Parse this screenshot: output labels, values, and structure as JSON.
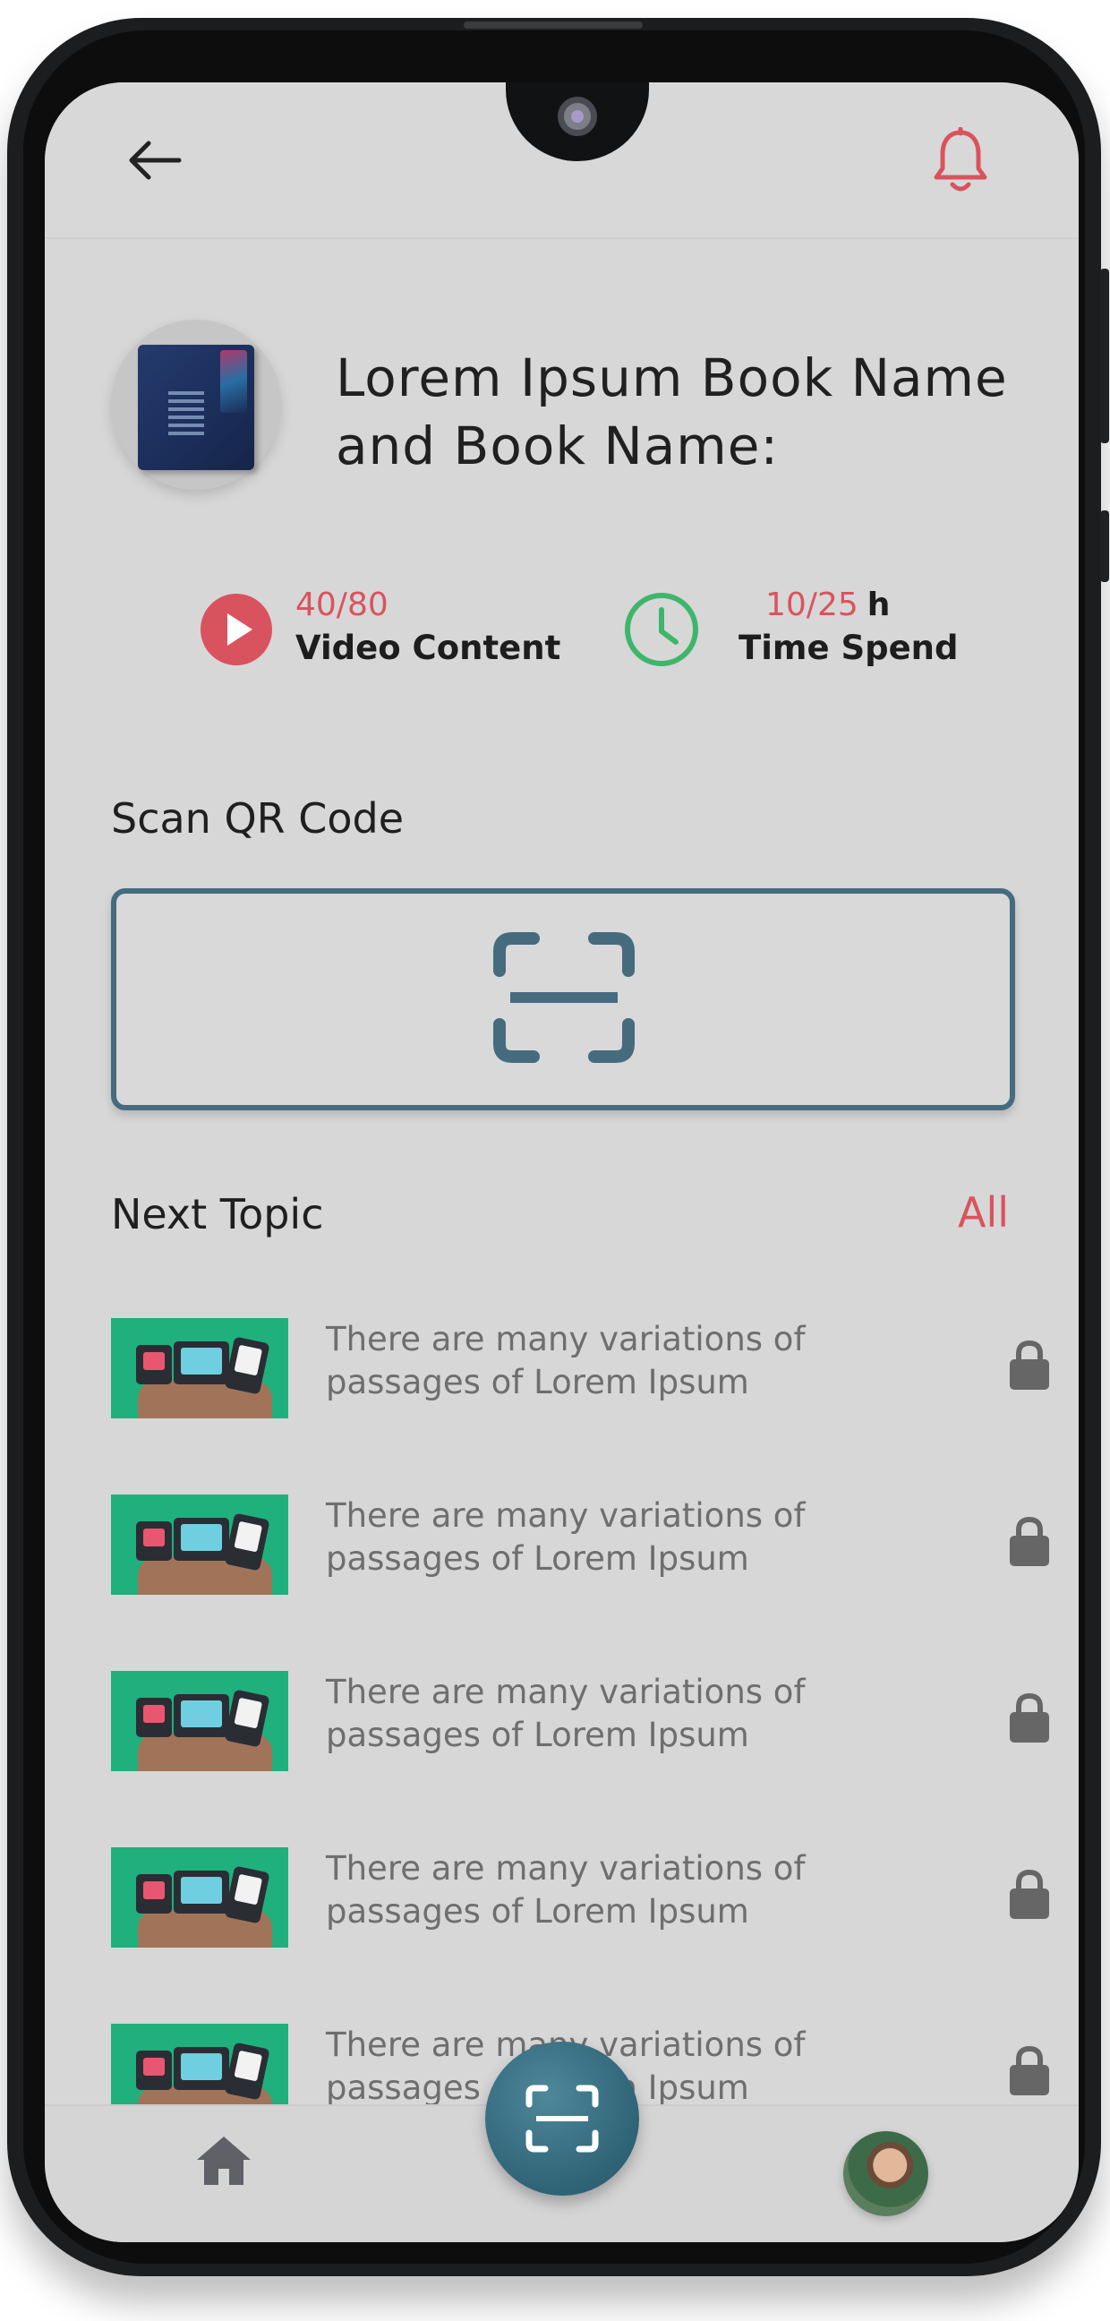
{
  "header": {
    "back_icon": "arrow-left-icon",
    "notification_icon": "bell-icon"
  },
  "book": {
    "title": "Lorem Ipsum Book Name and Book Name:"
  },
  "stats": {
    "video": {
      "count": "40/80",
      "label": "Video Content",
      "icon": "play-circle-icon",
      "color": "#d9535e"
    },
    "time": {
      "count": "10/25",
      "unit": "h",
      "label": "Time Spend",
      "icon": "clock-icon",
      "color": "#3fb56c"
    }
  },
  "scan": {
    "title": "Scan QR Code",
    "icon": "qr-scan-icon",
    "color": "#466b7e"
  },
  "next_topic": {
    "title": "Next Topic",
    "all_label": "All",
    "items": [
      {
        "text": "There are many variations of passages of Lorem Ipsum",
        "locked": true
      },
      {
        "text": "There are many variations of passages of Lorem Ipsum",
        "locked": true
      },
      {
        "text": "There are many variations of passages of Lorem Ipsum",
        "locked": true
      },
      {
        "text": "There are many variations of passages of Lorem Ipsum",
        "locked": true
      },
      {
        "text": "There are many variations of passages of Lorem Ipsum",
        "locked": true
      }
    ]
  },
  "bottom_nav": {
    "home_icon": "home-icon",
    "fab_icon": "qr-scan-icon",
    "profile": "avatar"
  },
  "colors": {
    "accent_red": "#d9535e",
    "accent_green": "#3fb56c",
    "accent_teal": "#466b7e",
    "background": "#d7d7d7"
  }
}
